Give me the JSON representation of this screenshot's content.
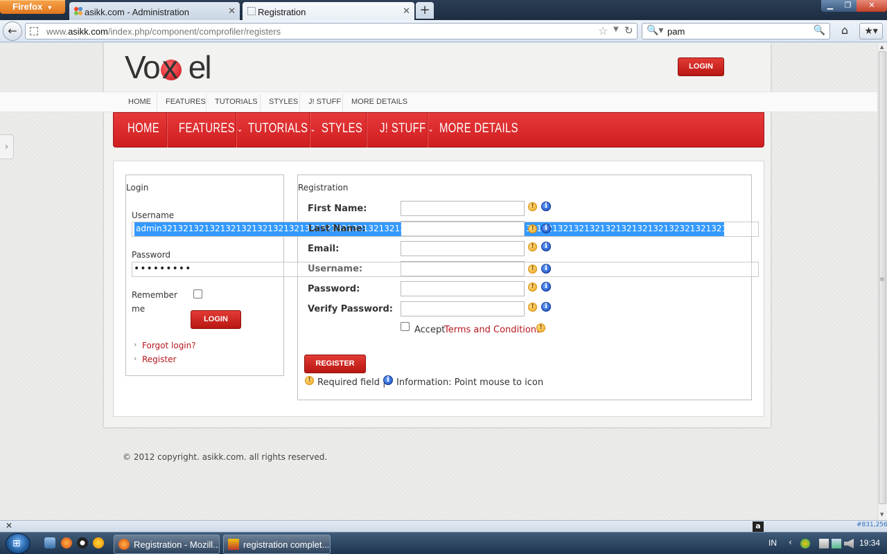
{
  "browser": {
    "menu_button": "Firefox",
    "tabs": [
      {
        "label": "asikk.com - Administration"
      },
      {
        "label": "Registration"
      }
    ],
    "url_prefix": "www.",
    "url_domain": "asikk.com",
    "url_path": "/index.php/component/comprofiler/registers",
    "search_value": "pam"
  },
  "site": {
    "logo_text_left": "Vo",
    "logo_text_right": "el",
    "logo_x": "x",
    "header_login": "LOGIN",
    "top_menu": [
      "HOME",
      "FEATURES",
      "TUTORIALS",
      "STYLES",
      "J! STUFF",
      "MORE DETAILS"
    ],
    "red_menu": [
      {
        "label": "HOME",
        "chevron": ""
      },
      {
        "label": "FEATURES",
        "chevron": "⌄"
      },
      {
        "label": "TUTORIALS",
        "chevron": "⌄"
      },
      {
        "label": "STYLES",
        "chevron": ""
      },
      {
        "label": "J! STUFF",
        "chevron": "⌄"
      },
      {
        "label": "MORE DETAILS",
        "chevron": ""
      }
    ]
  },
  "login": {
    "legend": "Login",
    "username_label": "Username",
    "username_value_a": "admin3213213213213213213213213213213213213213213213232",
    "username_value_b": "3213213213213213213213213213232132132131333213232321",
    "password_label": "Password",
    "password_dots": "•••••••••",
    "remember_label_1": "Remember",
    "remember_label_2": "me",
    "login_button": "LOGIN",
    "links": [
      "Forgot login?",
      "Register"
    ]
  },
  "registration": {
    "legend": "Registration",
    "fields": [
      {
        "label": "First Name:"
      },
      {
        "label": "Last Name:"
      },
      {
        "label": "Email:"
      },
      {
        "label": "Username:"
      },
      {
        "label": "Password:"
      },
      {
        "label": "Verify Password:"
      }
    ],
    "accept_text": "Accept",
    "terms_link": "Terms and Conditions",
    "register_button": "REGISTER",
    "required_text": "Required field |",
    "info_text": "Information: Point mouse to icon"
  },
  "footer": {
    "copyright": "© 2012 copyright. asikk.com. all rights reserved."
  },
  "statusbar": {
    "coords": "#831,256",
    "addon_letter": "a"
  },
  "taskbar": {
    "tasks": [
      {
        "label": "Registration - Mozill..."
      },
      {
        "label": "registration complet..."
      }
    ],
    "lang": "IN",
    "time": "19:34"
  },
  "colors": {
    "accent_red": "#d62426",
    "link_red": "#b5161c",
    "selection_blue": "#3399ff"
  }
}
